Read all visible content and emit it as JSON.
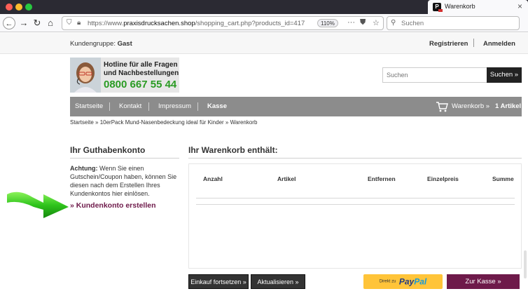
{
  "browser": {
    "tab_title": "Warenkorb",
    "tab_favicon_letter": "P",
    "url_prefix": "https://www.",
    "url_domain": "praxisdrucksachen.shop",
    "url_path": "/shopping_cart.php?products_id=417",
    "zoom": "110%",
    "search_placeholder": "Suchen"
  },
  "topbar": {
    "customer_group_label": "Kundengruppe:",
    "customer_group_value": "Gast",
    "register": "Registrieren",
    "login": "Anmelden"
  },
  "hotline": {
    "line1": "Hotline für alle Fragen",
    "line2": "und Nachbestellungen",
    "phone": "0800 667 55 44"
  },
  "search": {
    "placeholder": "Suchen",
    "button": "Suchen »"
  },
  "nav": {
    "items": [
      "Startseite",
      "Kontakt",
      "Impressum",
      "Kasse"
    ],
    "cart_label": "Warenkorb »",
    "cart_count": "1 Artikel"
  },
  "breadcrumb": "Startseite » 10erPack Mund-Nasenbedeckung ideal für Kinder » Warenkorb",
  "sidebar": {
    "title": "Ihr Guthabenkonto",
    "text_bold": "Achtung:",
    "text": " Wenn Sie einen Gutschein/Coupon haben, können Sie diesen nach dem Erstellen Ihres Kundenkontos hier einlösen.",
    "link": "» Kundenkonto erstellen"
  },
  "cart": {
    "title": "Ihr Warenkorb enthält:",
    "columns": [
      "Anzahl",
      "Artikel",
      "Entfernen",
      "Einzelpreis",
      "Summe"
    ]
  },
  "buttons": {
    "continue": "Einkauf fortsetzen »",
    "update": "Aktualisieren »",
    "paypal_prefix": "Direkt zu",
    "paypal_pay": "Pay",
    "paypal_pal": "Pal",
    "checkout": "Zur Kasse »"
  },
  "colors": {
    "accent": "#6e1a4a",
    "phone_green": "#2a9b23",
    "nav_gray": "#8c8c8c",
    "paypal_yellow": "#ffc439"
  }
}
